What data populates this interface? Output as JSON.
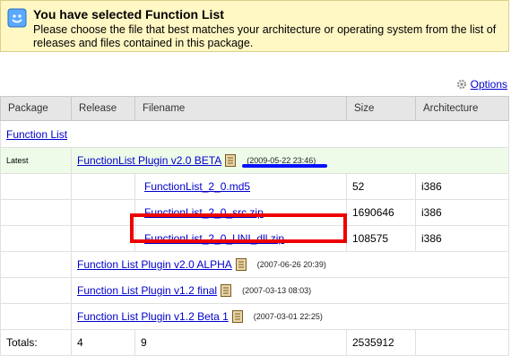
{
  "notice": {
    "title": "You have selected Function List",
    "description": "Please choose the file that best matches your architecture or operating system from the list of releases and files contained in this package."
  },
  "options_label": "Options",
  "table": {
    "headers": [
      "Package",
      "Release",
      "Filename",
      "Size",
      "Architecture"
    ],
    "package_name": "Function List",
    "latest_label": "Latest",
    "releases": [
      {
        "name": "FunctionList Plugin v2.0 BETA",
        "date": "(2009-05-22 23:46)"
      },
      {
        "name": "Function List Plugin v2.0 ALPHA",
        "date": "(2007-06-26 20:39)"
      },
      {
        "name": "Function List Plugin v1.2 final",
        "date": "(2007-03-13 08:03)"
      },
      {
        "name": "Function List Plugin v1.2 Beta 1",
        "date": "(2007-03-01 22:25)"
      }
    ],
    "files": [
      {
        "name": "FunctionList_2_0.md5",
        "size": "52",
        "arch": "i386"
      },
      {
        "name": "FunctionList_2_0_src.zip",
        "size": "1690646",
        "arch": "i386"
      },
      {
        "name": "FunctionList_2_0_UNI_dll.zip",
        "size": "108575",
        "arch": "i386"
      }
    ],
    "totals": {
      "label": "Totals:",
      "packages": "4",
      "releases": "9",
      "size": "2535912"
    }
  },
  "colors": {
    "highlight_box": "#ee0000",
    "underline_mark": "#0011ff",
    "notice_bg": "#fff7c4"
  }
}
